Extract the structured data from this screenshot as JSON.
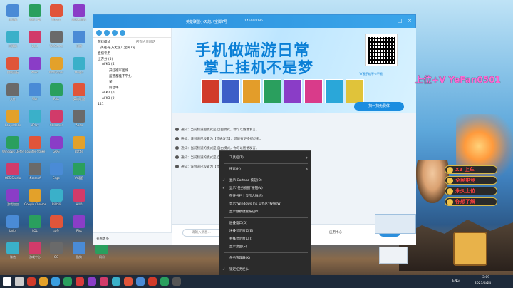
{
  "window": {
    "title": "英雄联盟小天炮八宝脚7号",
    "id_text": "145040096",
    "controls": [
      "minimize",
      "maximize",
      "close"
    ]
  },
  "sidebar": {
    "tree": [
      "游戏模式",
      "英雄·东方无极八宝脚7号",
      "直播专用",
      "上方分 (5)",
      "AFK1 (4)",
      "开红德军团城",
      "蓝营都挂不平扎",
      "某",
      "阿佳牛",
      "AFK2 (0)",
      "AFK3 (0)",
      "141"
    ],
    "tree_right_label": "所有人只听话",
    "bottom_label": "查看更多",
    "bottom_tools": [
      "mic",
      "speaker",
      "face",
      "smile"
    ]
  },
  "banner": {
    "line1": "手机做端游日常",
    "line2": "掌上挂机不是梦",
    "side_tag": "YY云手机不卡不限",
    "scan_button": "扫一扫免费体",
    "tiles": [
      "#d13b2a",
      "#3d5ec7",
      "#e39d2a",
      "#2a9f5e",
      "#8a3dc7",
      "#d93b8a",
      "#2aa7d9",
      "#e0c33a"
    ]
  },
  "chat": {
    "notices": [
      "通知：当前频道拍模式是 自由模式，你可以随便发言。",
      "通知：该频道已设置为【普通发言】，可能有更多提问者。",
      "通知：当前频道的模式是 自由模式，你可以随便发言。",
      "通知：当前频道的模式是 自由模式，你可以随便发言。",
      "通知：该频道已设置为【普通发言】，可能有更多提问者。"
    ],
    "input_placeholder": "请输入消息...",
    "bottom_actions": [
      "演奏伴奏",
      "普音"
    ],
    "send_label": "发送",
    "app_label": "应用中心"
  },
  "context_menu": {
    "items": [
      {
        "label": "工具栏(T)",
        "submenu": true,
        "checked": false
      },
      {
        "label": "搜索(H)",
        "submenu": true,
        "checked": false
      },
      {
        "label": "显示 Cortana 按钮(O)",
        "submenu": false,
        "checked": true
      },
      {
        "label": "显示\"任务视图\"按钮(V)",
        "submenu": false,
        "checked": true
      },
      {
        "label": "在任务栏上显示人脉(P)",
        "submenu": false,
        "checked": false
      },
      {
        "label": "显示\"Windows Ink 工作区\"按钮(W)",
        "submenu": false,
        "checked": false
      },
      {
        "label": "显示触摸键盘按钮(Y)",
        "submenu": false,
        "checked": false
      },
      {
        "label": "层叠窗口(D)",
        "submenu": false,
        "checked": false
      },
      {
        "label": "堆叠显示窗口(E)",
        "submenu": false,
        "checked": false
      },
      {
        "label": "并排显示窗口(I)",
        "submenu": false,
        "checked": false
      },
      {
        "label": "显示桌面(S)",
        "submenu": false,
        "checked": false
      },
      {
        "label": "任务管理器(K)",
        "submenu": false,
        "checked": false
      },
      {
        "label": "锁定任务栏(L)",
        "submenu": false,
        "checked": true
      },
      {
        "label": "任务栏设置(T)",
        "submenu": false,
        "checked": false
      }
    ]
  },
  "overlay": {
    "promo": "上位+V YeFan0501",
    "badges": [
      "X3 上车",
      "全民电竞",
      "永久上位",
      "你想了解"
    ]
  },
  "desktop": {
    "icons": [
      "此电脑",
      "网络下载",
      "Steam",
      "网易云音乐",
      "腾讯",
      "回收站",
      "Epic",
      "WeGame",
      "迅雷",
      "Logi",
      "控制面板",
      "Alien",
      "Wallpaper",
      "Origin",
      "QQ",
      "文件",
      "War",
      "Riot",
      "英雄联盟",
      "Apex",
      "Loupedeck",
      "UPlay",
      "CCleaner",
      "Apex",
      "Apex",
      "Windows Defender",
      "Counter-Strike",
      "GOG",
      "Battle",
      "CF",
      "OBS Studio",
      "Microsoft",
      "Edge",
      "YY语音",
      "TeamSpeak",
      "游戏加加",
      "Google Chrome",
      "Bilibili",
      "HUD",
      "Apex",
      "Unity",
      "LOL",
      "斗鱼",
      "Riot",
      "Apex",
      "微信",
      "游戏中心",
      "QQ",
      "酷狗",
      "网易"
    ]
  },
  "taskbar": {
    "time": "3:09",
    "date": "2021/4/24",
    "lang": "ENG"
  },
  "colors": {
    "accent": "#2c8fdc",
    "menu_bg": "#2b2b2b",
    "promo": "#ff6ad5"
  }
}
